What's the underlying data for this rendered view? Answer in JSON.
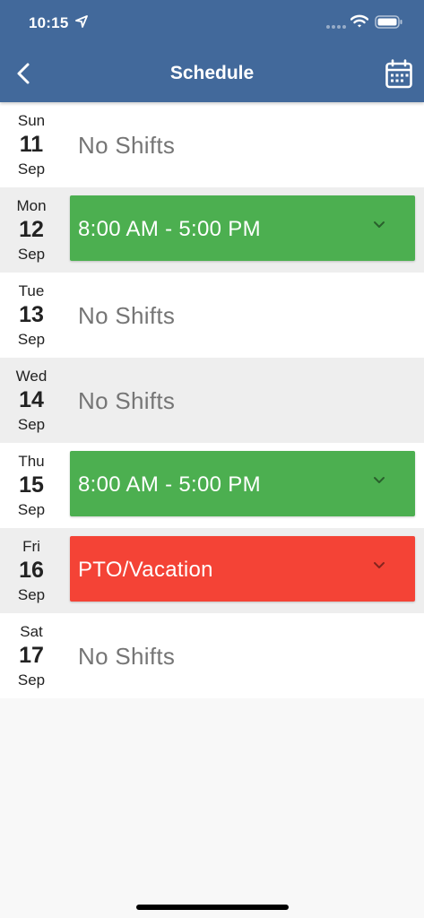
{
  "status_bar": {
    "time": "10:15"
  },
  "header": {
    "title": "Schedule"
  },
  "colors": {
    "header_bg": "#42699b",
    "shift_green": "#4caf50",
    "shift_red": "#f44336"
  },
  "days": [
    {
      "dow": "Sun",
      "day": "11",
      "month": "Sep",
      "shift": null,
      "empty_label": "No Shifts"
    },
    {
      "dow": "Mon",
      "day": "12",
      "month": "Sep",
      "shift": {
        "label": "8:00 AM - 5:00 PM",
        "color": "#4caf50"
      }
    },
    {
      "dow": "Tue",
      "day": "13",
      "month": "Sep",
      "shift": null,
      "empty_label": "No Shifts"
    },
    {
      "dow": "Wed",
      "day": "14",
      "month": "Sep",
      "shift": null,
      "empty_label": "No Shifts"
    },
    {
      "dow": "Thu",
      "day": "15",
      "month": "Sep",
      "shift": {
        "label": "8:00 AM - 5:00 PM",
        "color": "#4caf50"
      }
    },
    {
      "dow": "Fri",
      "day": "16",
      "month": "Sep",
      "shift": {
        "label": "PTO/Vacation",
        "color": "#f44336"
      }
    },
    {
      "dow": "Sat",
      "day": "17",
      "month": "Sep",
      "shift": null,
      "empty_label": "No Shifts"
    }
  ]
}
